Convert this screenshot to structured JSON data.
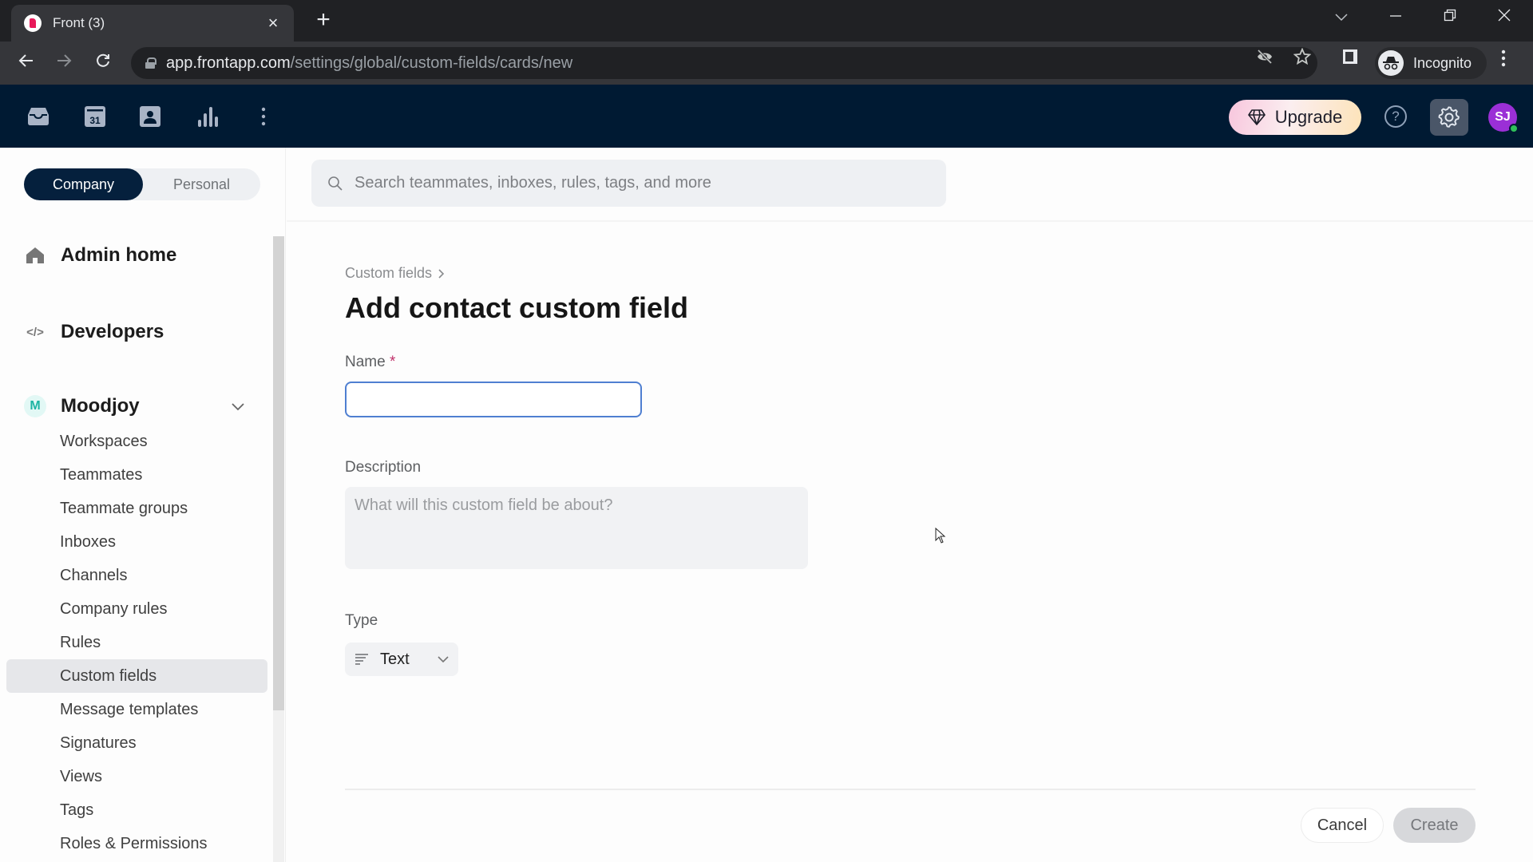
{
  "browser": {
    "tab_title": "Front (3)",
    "url_host": "app.frontapp.com",
    "url_path": "/settings/global/custom-fields/cards/new",
    "profile_label": "Incognito"
  },
  "appbar": {
    "upgrade_label": "Upgrade",
    "avatar_initials": "SJ",
    "calendar_day": "31"
  },
  "sidebar": {
    "scope": {
      "company": "Company",
      "personal": "Personal",
      "selected": "Company"
    },
    "admin_home": "Admin home",
    "developers": "Developers",
    "org": {
      "badge": "M",
      "name": "Moodjoy"
    },
    "items": [
      {
        "label": "Workspaces"
      },
      {
        "label": "Teammates"
      },
      {
        "label": "Teammate groups"
      },
      {
        "label": "Inboxes"
      },
      {
        "label": "Channels"
      },
      {
        "label": "Company rules"
      },
      {
        "label": "Rules"
      },
      {
        "label": "Custom fields",
        "active": true
      },
      {
        "label": "Message templates"
      },
      {
        "label": "Signatures"
      },
      {
        "label": "Views"
      },
      {
        "label": "Tags"
      },
      {
        "label": "Roles & Permissions"
      }
    ]
  },
  "main": {
    "search_placeholder": "Search teammates, inboxes, rules, tags, and more",
    "breadcrumb": "Custom fields",
    "title": "Add contact custom field",
    "form": {
      "name_label": "Name",
      "name_required": "*",
      "name_value": "",
      "description_label": "Description",
      "description_placeholder": "What will this custom field be about?",
      "type_label": "Type",
      "type_value": "Text"
    },
    "cancel_label": "Cancel",
    "create_label": "Create"
  }
}
